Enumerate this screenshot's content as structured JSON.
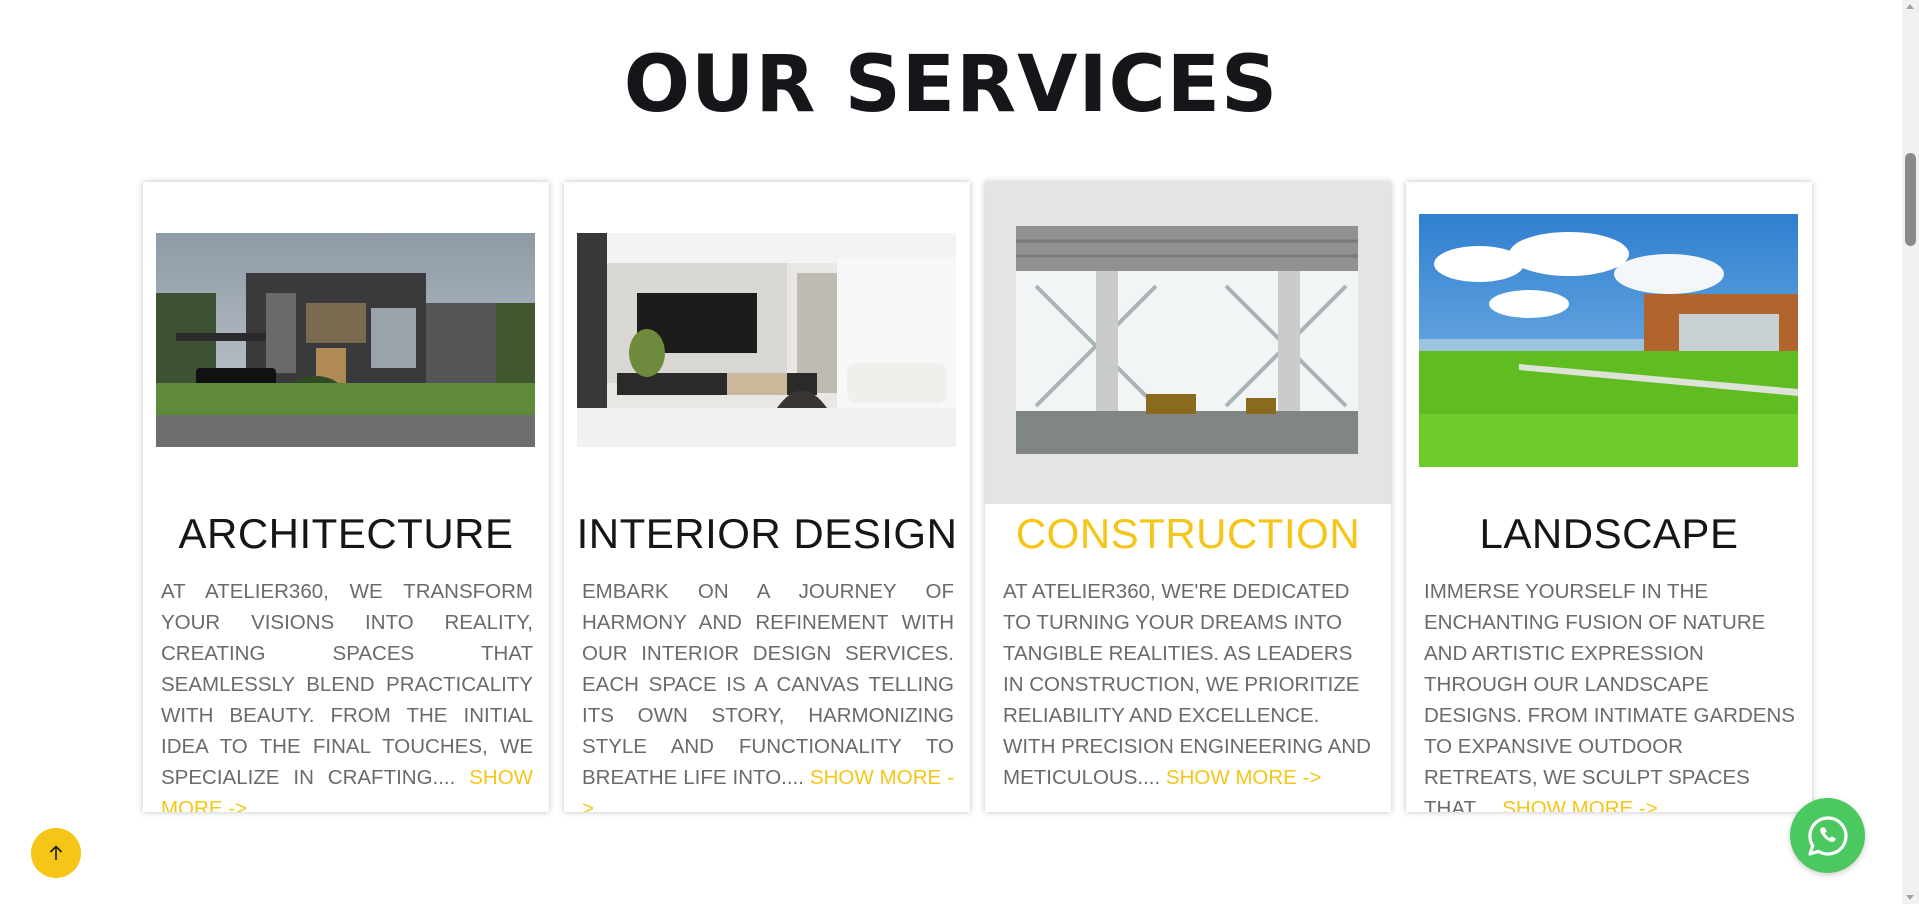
{
  "page": {
    "title": "OUR SERVICES"
  },
  "services": [
    {
      "title": "ARCHITECTURE",
      "text": "AT ATELIER360, WE TRANSFORM YOUR VISIONS INTO REALITY, CREATING SPACES THAT SEAMLESSLY BLEND PRACTICALITY WITH BEAUTY. FROM THE INITIAL IDEA TO THE FINAL TOUCHES, WE SPECIALIZE IN CRAFTING....",
      "link": "SHOW MORE ->",
      "image": "modern-house-photo"
    },
    {
      "title": "INTERIOR DESIGN",
      "text": "EMBARK ON A JOURNEY OF HARMONY AND REFINEMENT WITH OUR INTERIOR DESIGN SERVICES. EACH SPACE IS A CANVAS TELLING ITS OWN STORY, HARMONIZING STYLE AND FUNCTIONALITY TO BREATHE LIFE INTO....",
      "link": "SHOW MORE ->",
      "image": "living-room-photo"
    },
    {
      "title": "CONSTRUCTION",
      "text": "AT ATELIER360, WE'RE DEDICATED TO TURNING YOUR DREAMS INTO TANGIBLE REALITIES. AS LEADERS IN CONSTRUCTION, WE PRIORITIZE RELIABILITY AND EXCELLENCE. WITH PRECISION ENGINEERING AND METICULOUS....",
      "link": "SHOW MORE ->",
      "image": "building-interior-photo"
    },
    {
      "title": "LANDSCAPE",
      "text": "IMMERSE YOURSELF IN THE ENCHANTING FUSION OF NATURE AND ARTISTIC EXPRESSION THROUGH OUR LANDSCAPE DESIGNS. FROM INTIMATE GARDENS TO EXPANSIVE OUTDOOR RETREATS, WE SCULPT SPACES THAT....",
      "link": "SHOW MORE ->",
      "image": "lawn-house-photo"
    }
  ],
  "floating": {
    "back_to_top_icon": "arrow-up-icon",
    "chat_icon": "whatsapp-icon"
  },
  "colors": {
    "accent": "#f5c518",
    "heading": "#16161a",
    "body_text": "#6a6a6a",
    "whatsapp": "#4cc861",
    "active_card_media": "#e4e4e4"
  }
}
